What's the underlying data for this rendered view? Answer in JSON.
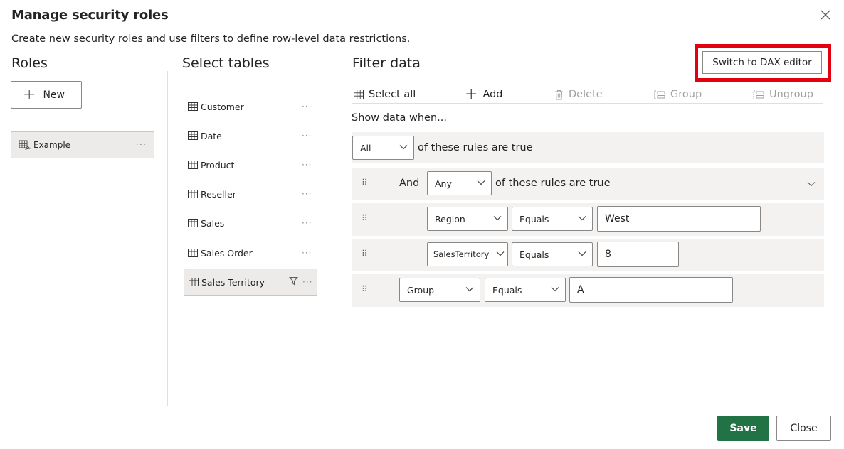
{
  "dialog": {
    "title": "Manage security roles",
    "subtitle": "Create new security roles and use filters to define row-level data restrictions.",
    "close_icon": "close-icon"
  },
  "roles": {
    "heading": "Roles",
    "new_label": "New",
    "items": [
      {
        "label": "Example"
      }
    ]
  },
  "tables": {
    "heading": "Select tables",
    "items": [
      {
        "label": "Customer"
      },
      {
        "label": "Date"
      },
      {
        "label": "Product"
      },
      {
        "label": "Reseller"
      },
      {
        "label": "Sales"
      },
      {
        "label": "Sales Order"
      },
      {
        "label": "Sales Territory"
      }
    ],
    "selected": "Sales Territory"
  },
  "filter": {
    "heading": "Filter data",
    "dax_button": "Switch to DAX editor",
    "toolbar": {
      "select_all": "Select all",
      "add": "Add",
      "delete": "Delete",
      "group": "Group",
      "ungroup": "Ungroup"
    },
    "show_when": "Show data when...",
    "top_rule": {
      "quantifier": "All",
      "suffix": "of these rules are true"
    },
    "group_rule": {
      "connector": "And",
      "quantifier": "Any",
      "suffix": "of these rules are true"
    },
    "conditions": [
      {
        "column": "Region",
        "operator": "Equals",
        "value": "West"
      },
      {
        "column": "SalesTerritory",
        "operator": "Equals",
        "value": "8"
      },
      {
        "column": "Group",
        "operator": "Equals",
        "value": "A"
      }
    ]
  },
  "footer": {
    "save": "Save",
    "close": "Close"
  },
  "colors": {
    "accent": "#217346",
    "highlight": "#e3000f"
  }
}
